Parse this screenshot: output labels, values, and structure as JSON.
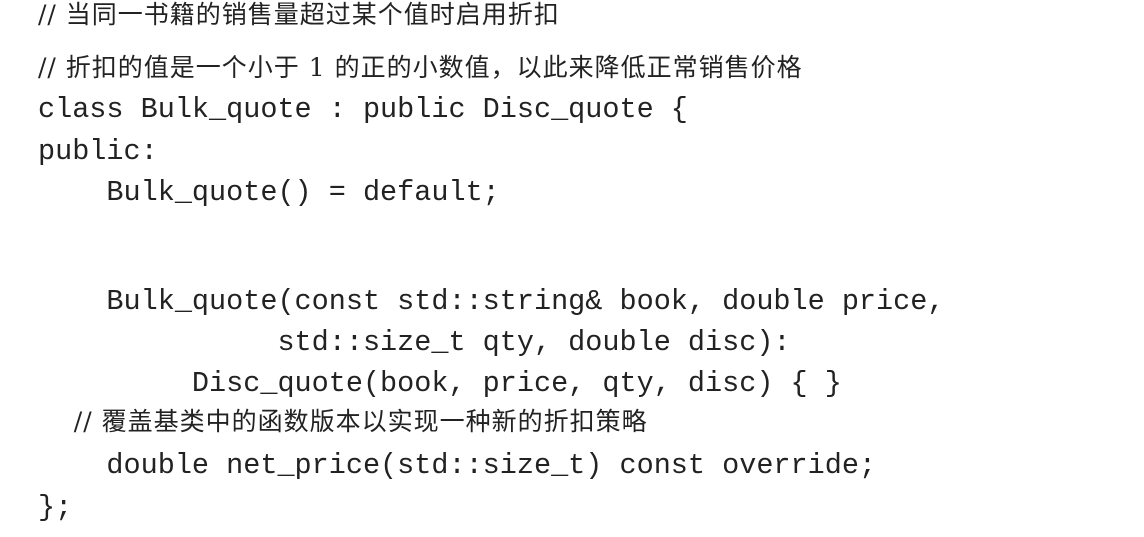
{
  "code_lines": [
    "// 当同一书籍的销售量超过某个值时启用折扣",
    "// 折扣的值是一个小于 1 的正的小数值，以此来降低正常销售价格",
    "class Bulk_quote : public Disc_quote {",
    "public:",
    "    Bulk_quote() = default;",
    "    Bulk_quote(const std::string& book, double price,",
    "              std::size_t qty, double disc):",
    "         Disc_quote(book, price, qty, disc) { }",
    "    // 覆盖基类中的函数版本以实现一种新的折扣策略",
    "    double net_price(std::size_t) const override;",
    "};"
  ]
}
